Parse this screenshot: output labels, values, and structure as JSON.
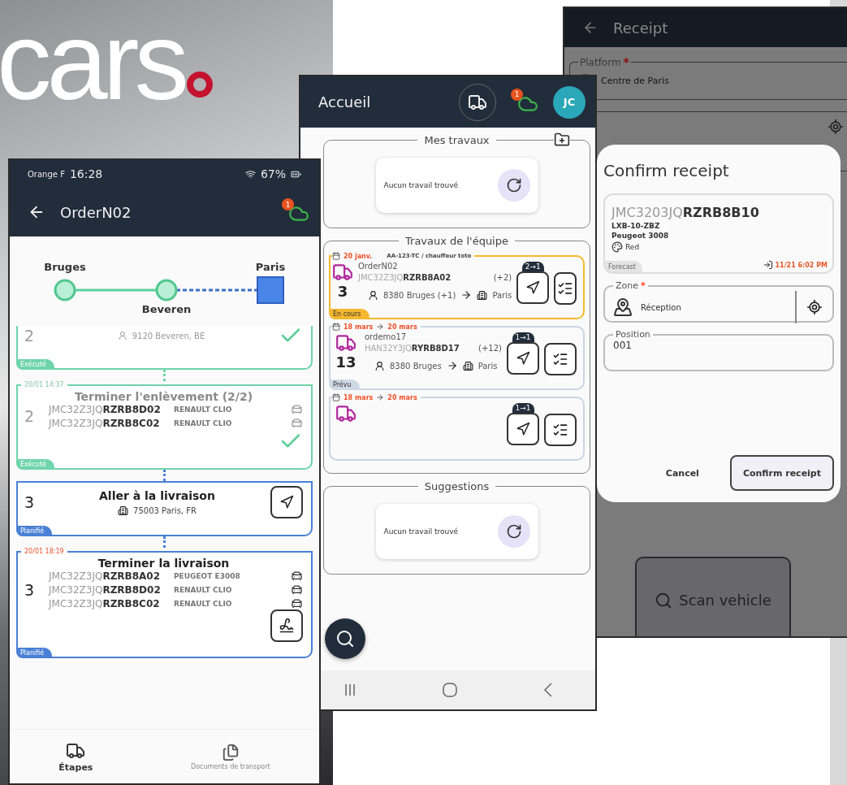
{
  "brand": {
    "text": "cars"
  },
  "order_screen": {
    "status_bar": {
      "carrier": "Orange F",
      "time": "16:28",
      "battery": "67%"
    },
    "title": "OrderN02",
    "sync_badge": "1",
    "route": [
      {
        "name": "Bruges",
        "done": true
      },
      {
        "name": "Beveren",
        "done": true
      },
      {
        "name": "Paris",
        "done": false
      }
    ],
    "steps": [
      {
        "kind": "travel",
        "number": "2",
        "address": "9120 Beveren, BE",
        "status": "Exécuté",
        "done": true
      },
      {
        "kind": "task",
        "time": "20/01 14:37",
        "title": "Terminer l'enlèvement (2/2)",
        "number": "2",
        "status": "Exécuté",
        "done": true,
        "vehicles": [
          {
            "vin": "JMC32Z3JQ**RZRB8D02**",
            "model": "RENAULT CLIO"
          },
          {
            "vin": "JMC32Z3JQ**RZRB8C02**",
            "model": "RENAULT CLIO"
          }
        ]
      },
      {
        "kind": "travel",
        "number": "3",
        "title": "Aller à la livraison",
        "address": "75003 Paris, FR",
        "status": "Planifié",
        "done": false
      },
      {
        "kind": "task",
        "time": "20/01 18:19",
        "title": "Terminer la livraison",
        "number": "3",
        "status": "Planifié",
        "done": false,
        "vehicles": [
          {
            "vin": "JMC32Z3JQ**RZRB8A02**",
            "model": "PEUGEOT E3008"
          },
          {
            "vin": "JMC32Z3JQ**RZRB8D02**",
            "model": "RENAULT CLIO"
          },
          {
            "vin": "JMC32Z3JQ**RZRB8C02**",
            "model": "RENAULT CLIO"
          }
        ]
      }
    ],
    "tabs": [
      {
        "label": "Étapes",
        "selected": true
      },
      {
        "label": "Documents de transport",
        "selected": false
      }
    ]
  },
  "home_screen": {
    "title": "Accueil",
    "sync_badge": "1",
    "avatar": "JC",
    "sections": [
      {
        "kind": "empty",
        "title": "Mes travaux",
        "empty_text": "Aucun travail trouvé"
      },
      {
        "kind": "jobs",
        "title": "Travaux de l'équipe",
        "jobs": [
          {
            "in_progress": true,
            "date": "20 janv.",
            "driver": "AA-123-TC / chauffeur toto",
            "name": "OrderN02",
            "vin": "JMC32Z3JQ**RZRB8A02**",
            "extra": "(+2)",
            "count": "3",
            "from": "8380 Bruges (+1)",
            "to": "Paris",
            "transfer": "2→1",
            "status": "En cours"
          },
          {
            "in_progress": false,
            "date": "18 mars",
            "date_end": "20 mars",
            "name": "ordemo17",
            "vin": "HAN32Y3JQ**RYRB8D17**",
            "extra": "(+12)",
            "count": "13",
            "from": "8380 Bruges",
            "to": "Paris",
            "transfer": "1→1",
            "status": "Prévu"
          },
          {
            "in_progress": false,
            "date": "18 mars",
            "date_end": "20 mars",
            "transfer": "1→1"
          }
        ]
      },
      {
        "kind": "empty",
        "title": "Suggestions",
        "empty_text": "Aucun travail trouvé"
      }
    ]
  },
  "receipt_screen": {
    "title": "Receipt",
    "platform": {
      "label": "Platform",
      "required_mark": "*",
      "value": "Centre de Paris"
    },
    "dialog": {
      "title": "Confirm receipt",
      "vehicle": {
        "vin": "JMC3203JQ**RZRB8B10**",
        "plate": "LXB-10-ZBZ",
        "model": "Peugeot 3008",
        "color_name": "Red",
        "status": "Forecast",
        "arrival": "11/21 6:02 PM"
      },
      "zone": {
        "label": "Zone",
        "required_mark": "*",
        "value": "Réception"
      },
      "position": {
        "label": "Position",
        "value": "001"
      },
      "buttons": [
        {
          "kind": "text",
          "label": "Cancel"
        },
        {
          "kind": "outlined",
          "label": "Confirm receipt"
        }
      ]
    },
    "scan_button": "Scan vehicle"
  }
}
